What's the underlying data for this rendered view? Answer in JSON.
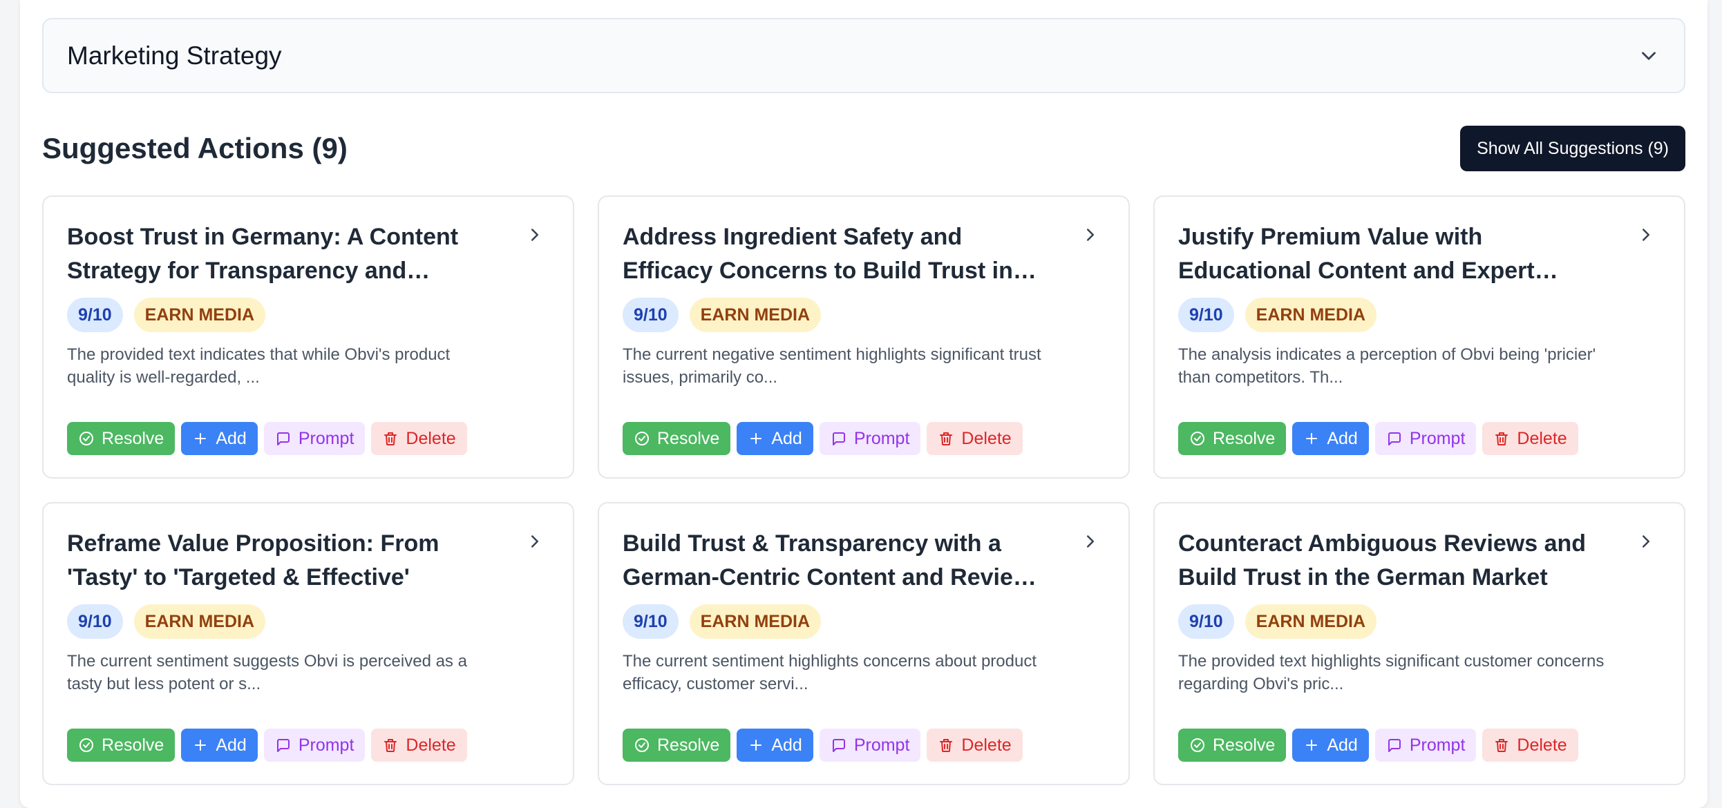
{
  "accordion": {
    "title": "Marketing Strategy",
    "icon": "chevron-down-icon"
  },
  "section": {
    "title": "Suggested Actions (9)",
    "show_all_label": "Show All Suggestions (9)"
  },
  "buttons": {
    "resolve": "Resolve",
    "add": "Add",
    "prompt": "Prompt",
    "delete": "Delete"
  },
  "colors": {
    "resolve": "#4cb861",
    "add": "#3b82f6",
    "prompt_bg": "#f3e8ff",
    "delete_bg": "#fde2e2",
    "dark": "#0f172a"
  },
  "cards": [
    {
      "title": "Boost Trust in Germany: A Content Strategy for Transparency and Service Excellence",
      "score": "9/10",
      "type": "EARN MEDIA",
      "description": "The provided text indicates that while Obvi's product quality is well-regarded, ..."
    },
    {
      "title": "Address Ingredient Safety and Efficacy Concerns to Build Trust in the German Market",
      "score": "9/10",
      "type": "EARN MEDIA",
      "description": "The current negative sentiment highlights significant trust issues, primarily co..."
    },
    {
      "title": "Justify Premium Value with Educational Content and Expert Endorsements",
      "score": "9/10",
      "type": "EARN MEDIA",
      "description": "The analysis indicates a perception of Obvi being 'pricier' than competitors. Th..."
    },
    {
      "title": "Reframe Value Proposition: From 'Tasty' to 'Targeted & Effective'",
      "score": "9/10",
      "type": "EARN MEDIA",
      "description": "The current sentiment suggests Obvi is perceived as a tasty but less potent or s..."
    },
    {
      "title": "Build Trust & Transparency with a German-Centric Content and Review Strategy",
      "score": "9/10",
      "type": "EARN MEDIA",
      "description": "The current sentiment highlights concerns about product efficacy, customer servi..."
    },
    {
      "title": "Counteract Ambiguous Reviews and Build Trust in the German Market",
      "score": "9/10",
      "type": "EARN MEDIA",
      "description": "The provided text highlights significant customer concerns regarding Obvi's pric..."
    }
  ]
}
